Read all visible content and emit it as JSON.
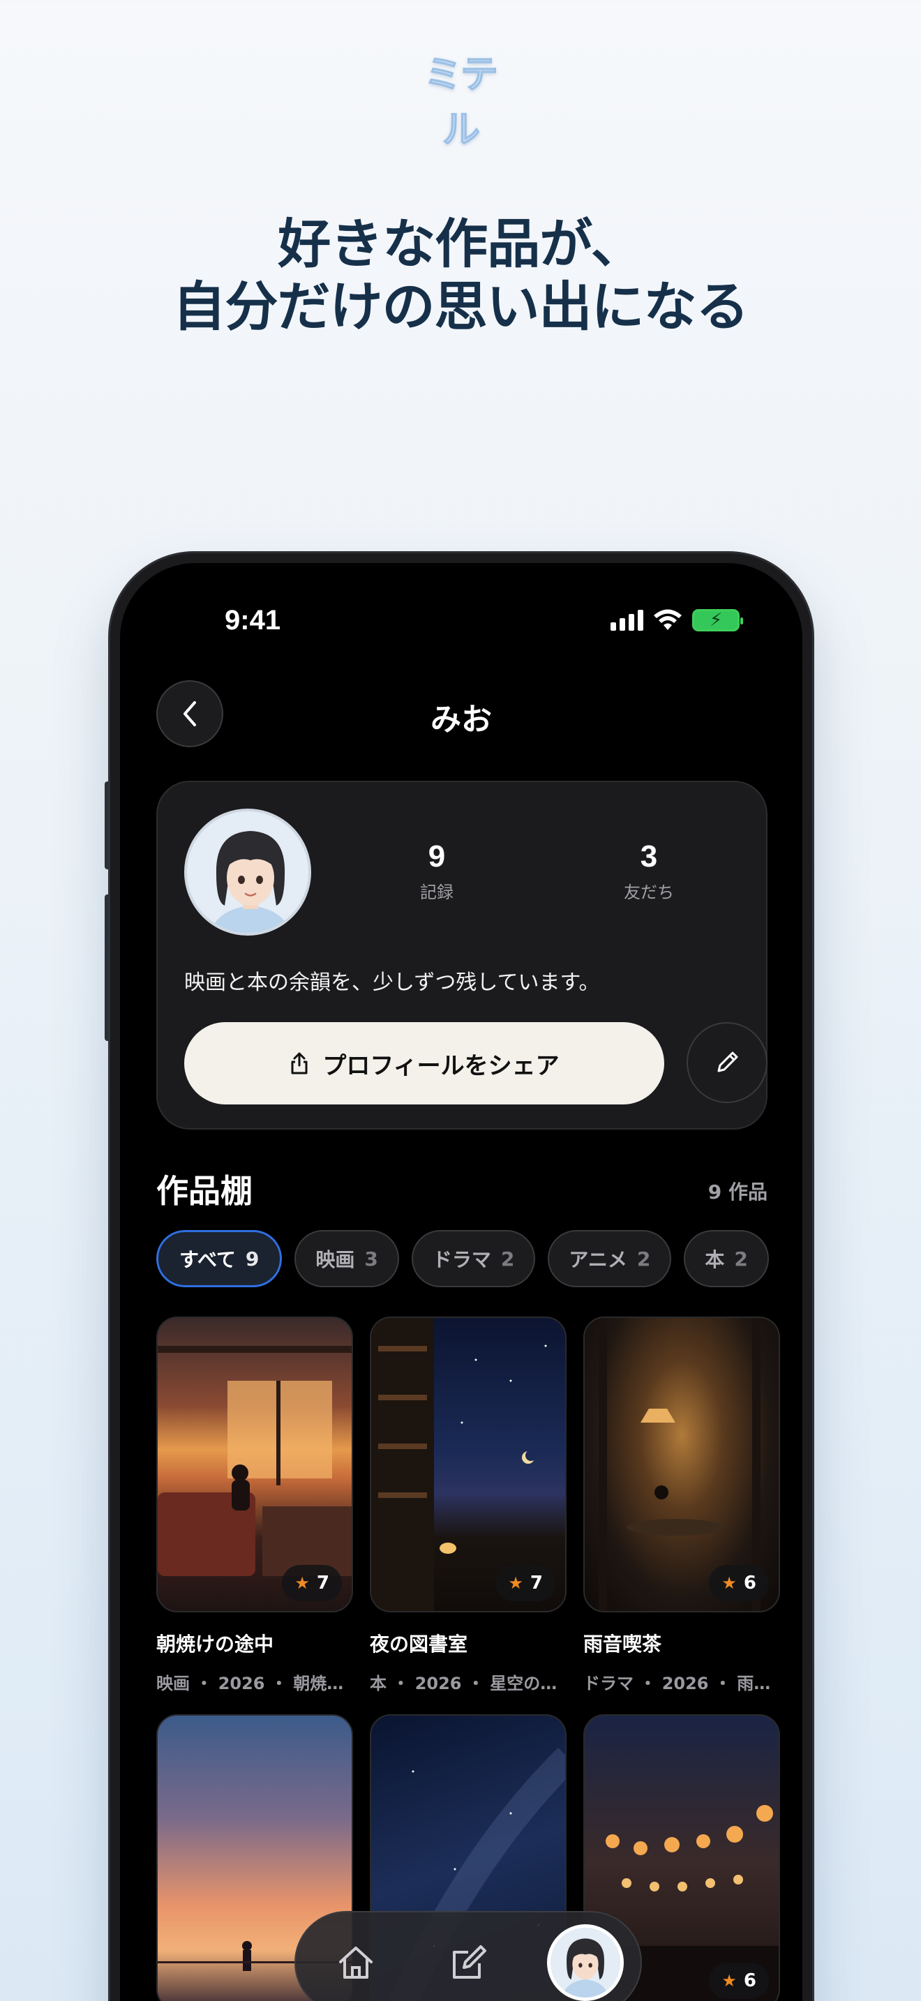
{
  "brand": {
    "logo_text": "ミテル"
  },
  "headline": {
    "line1": "好きな作品が、",
    "line2": "自分だけの思い出になる"
  },
  "status_bar": {
    "time": "9:41"
  },
  "nav": {
    "title": "みお"
  },
  "profile": {
    "stats": [
      {
        "value": "9",
        "label": "記録"
      },
      {
        "value": "3",
        "label": "友だち"
      }
    ],
    "bio": "映画と本の余韻を、少しずつ残しています。",
    "share_label": "プロフィールをシェア"
  },
  "shelf": {
    "title": "作品棚",
    "count": "9 作品",
    "filters": [
      {
        "label": "すべて",
        "count": "9",
        "active": true
      },
      {
        "label": "映画",
        "count": "3",
        "active": false
      },
      {
        "label": "ドラマ",
        "count": "2",
        "active": false
      },
      {
        "label": "アニメ",
        "count": "2",
        "active": false
      },
      {
        "label": "本",
        "count": "2",
        "active": false
      }
    ],
    "works": [
      {
        "title": "朝焼けの途中",
        "meta": "映画 ・ 2026 ・ 朝焼け…",
        "rating": "7"
      },
      {
        "title": "夜の図書室",
        "meta": "本 ・ 2026 ・ 星空の図…",
        "rating": "7"
      },
      {
        "title": "雨音喫茶",
        "meta": "ドラマ ・ 2026 ・ 雨の…",
        "rating": "6"
      },
      {
        "title": "",
        "meta": "",
        "rating": ""
      },
      {
        "title": "",
        "meta": "",
        "rating": ""
      },
      {
        "title": "",
        "meta": "",
        "rating": "6"
      }
    ]
  },
  "tabbar": {
    "items": [
      "home-icon",
      "compose-icon",
      "profile-avatar"
    ]
  },
  "colors": {
    "accent": "#2f6fe0",
    "star": "#f08a24",
    "headline": "#16304a"
  }
}
